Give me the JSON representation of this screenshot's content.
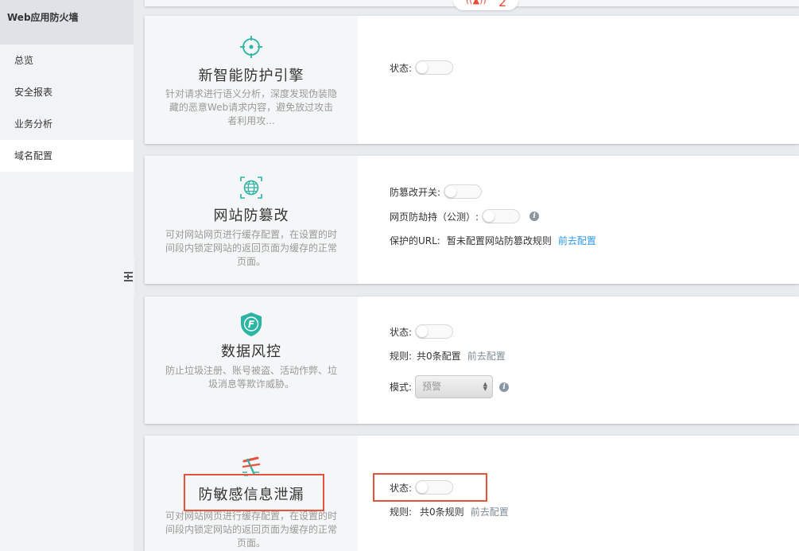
{
  "sidebar": {
    "title": "Web应用防火墙",
    "items": [
      {
        "label": "总览",
        "active": false
      },
      {
        "label": "安全报表",
        "active": false
      },
      {
        "label": "业务分析",
        "active": false
      },
      {
        "label": "域名配置",
        "active": true
      }
    ]
  },
  "top_badge": {
    "count": "2"
  },
  "cards": {
    "engine": {
      "title": "新智能防护引擎",
      "desc": "针对请求进行语义分析，深度发现伪装隐藏的恶意Web请求内容，避免放过攻击者利用攻...",
      "status_label": "状态:"
    },
    "tamper": {
      "title": "网站防篡改",
      "desc": "可对网站网页进行缓存配置，在设置的时间段内锁定网站的返回页面为缓存的正常页面。",
      "switch_label": "防篡改开关:",
      "hijack_label": "网页防劫持（公测）:",
      "url_label": "保护的URL:",
      "url_value": "暂未配置网站防篡改规则",
      "url_link": "前去配置"
    },
    "risk": {
      "title": "数据风控",
      "desc": "防止垃圾注册、账号被盗、活动作弊、垃圾消息等欺诈威胁。",
      "status_label": "状态:",
      "rule_label": "规则:",
      "rule_value": "共0条配置",
      "rule_link": "前去配置",
      "mode_label": "模式:",
      "mode_value": "预警"
    },
    "leak": {
      "title": "防敏感信息泄漏",
      "desc": "可对网站网页进行缓存配置，在设置的时间段内锁定网站的返回页面为缓存的正常页面。",
      "status_label": "状态:",
      "rule_label": "规则:",
      "rule_value": "共0条规则",
      "rule_link": "前去配置"
    }
  },
  "colors": {
    "accent": "#2d9ae8",
    "icon_teal": "#2bb5a5",
    "highlight": "#e5533d"
  },
  "icons": [
    "target-icon",
    "globe-scan-icon",
    "shield-f-icon",
    "leak-icon",
    "info-icon",
    "collapse-icon",
    "bell-icon"
  ]
}
